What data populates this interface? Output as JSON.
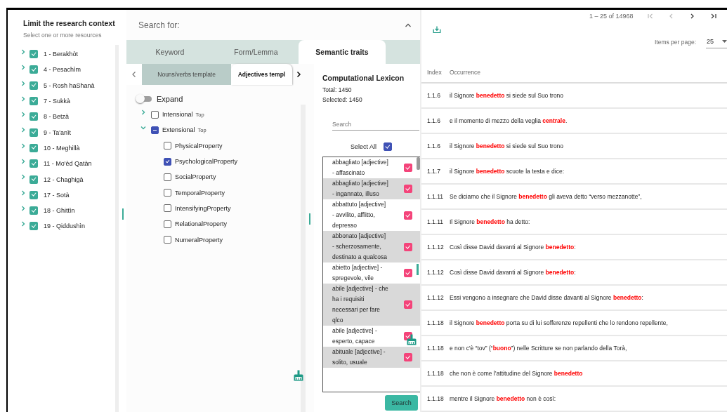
{
  "resources_panel": {
    "title": "Limit the research context",
    "subtitle": "Select one or more resources",
    "items": [
      {
        "label": "1 - Berakhòt",
        "checked": true,
        "expanded": false
      },
      {
        "label": "4 - Pesachìm",
        "checked": true,
        "expanded": false
      },
      {
        "label": "5 - Rosh haShanà",
        "checked": true,
        "expanded": false
      },
      {
        "label": "7 - Sukkà",
        "checked": true,
        "expanded": false
      },
      {
        "label": "8 - Betzà",
        "checked": true,
        "expanded": false
      },
      {
        "label": "9 - Ta'anìt",
        "checked": true,
        "expanded": false
      },
      {
        "label": "10 - Meghillà",
        "checked": true,
        "expanded": false
      },
      {
        "label": "11 - Mo'èd Qatàn",
        "checked": true,
        "expanded": false
      },
      {
        "label": "12 - Chaghigà",
        "checked": true,
        "expanded": false
      },
      {
        "label": "17 - Sotà",
        "checked": true,
        "expanded": false
      },
      {
        "label": "18 - Ghittìn",
        "checked": true,
        "expanded": false
      },
      {
        "label": "19 - Qiddushìn",
        "checked": true,
        "expanded": false
      }
    ]
  },
  "search_panel": {
    "title": "Search for:",
    "tabs": [
      {
        "label": "Keyword",
        "selected": false
      },
      {
        "label": "Form/Lemma",
        "selected": false
      },
      {
        "label": "Semantic traits",
        "selected": true
      }
    ],
    "subtabs": [
      {
        "label": "Nouns/verbs template",
        "selected": false
      },
      {
        "label": "Adjectives templ",
        "selected": true
      }
    ],
    "expand_toggle": {
      "label": "Expand",
      "on": false
    },
    "tree": [
      {
        "label": "Intensional",
        "tag": "Top",
        "checked": false,
        "expanded": false
      },
      {
        "label": "Extensional",
        "tag": "Top",
        "indeterminate": true,
        "expanded": true,
        "children": [
          {
            "label": "PhysicalProperty",
            "checked": false
          },
          {
            "label": "PsychologicalProperty",
            "checked": true
          },
          {
            "label": "SocialProperty",
            "checked": false
          },
          {
            "label": "TemporalProperty",
            "checked": false
          },
          {
            "label": "IntensifyingProperty",
            "checked": false
          },
          {
            "label": "RelationalProperty",
            "checked": false
          },
          {
            "label": "NumeralProperty",
            "checked": false
          }
        ]
      }
    ]
  },
  "lexicon": {
    "title": "Computational Lexicon",
    "total": "Total: 1450",
    "selected_count": "Selected: 1450",
    "search": {
      "placeholder": "Search"
    },
    "select_all": {
      "label": "Select All",
      "checked": true
    },
    "entries": [
      {
        "text": "abbagliato [adjective] - affascinato",
        "checked": true
      },
      {
        "text": "abbagliato [adjective] - ingannato, illuso",
        "checked": true
      },
      {
        "text": "abbattuto [adjective] - avvilito, afflitto, depresso",
        "checked": true
      },
      {
        "text": "abbonato [adjective] - scherzosamente, destinato a qualcosa",
        "checked": true
      },
      {
        "text": "abietto [adjective] - spregevole, vile",
        "checked": true
      },
      {
        "text": "abile [adjective] - che ha i requisiti necessari per fare qlco",
        "checked": true
      },
      {
        "text": "abile [adjective] - esperto, capace",
        "checked": true
      },
      {
        "text": "abituale [adjective] - solito, usuale",
        "checked": true
      }
    ],
    "search_button": "Search"
  },
  "results": {
    "range": "1 – 25 of 14968",
    "items_per_page_label": "Items per page:",
    "items_per_page": "25",
    "columns": [
      "Index",
      "Occurrence"
    ],
    "rows": [
      {
        "index": "1.1.6",
        "occurrence": "il Signore **benedetto** si siede sul Suo trono"
      },
      {
        "index": "1.1.6",
        "occurrence": "e il momento di mezzo della veglia **centrale**."
      },
      {
        "index": "1.1.6",
        "occurrence": "il Signore **benedetto** si siede sul Suo trono"
      },
      {
        "index": "1.1.7",
        "occurrence": "il Signore **benedetto** scuote la testa e dice:"
      },
      {
        "index": "1.1.11",
        "occurrence": "Se diciamo che il Signore **benedetto** gli aveva detto “verso mezzanotte”,"
      },
      {
        "index": "1.1.11",
        "occurrence": "Il Signore **benedetto** ha detto:"
      },
      {
        "index": "1.1.12",
        "occurrence": "Così disse David davanti al Signore **benedetto**:"
      },
      {
        "index": "1.1.12",
        "occurrence": "Così disse David davanti al Signore **benedetto**:"
      },
      {
        "index": "1.1.12",
        "occurrence": "Essi vengono a insegnare che David disse davanti al Signore **benedetto**:"
      },
      {
        "index": "1.1.18",
        "occurrence": "il Signore **benedetto** porta su di lui sofferenze repellenti che lo rendono repellente,"
      },
      {
        "index": "1.1.18",
        "occurrence": "e non c'è “tov” (“**buono**”) nelle Scritture se non parlando della Torà,"
      },
      {
        "index": "1.1.18",
        "occurrence": "che non è come l’attitudine del Signore **benedetto**"
      },
      {
        "index": "1.1.18",
        "occurrence": "mentre il Signore **benedetto** non è così:"
      }
    ]
  }
}
